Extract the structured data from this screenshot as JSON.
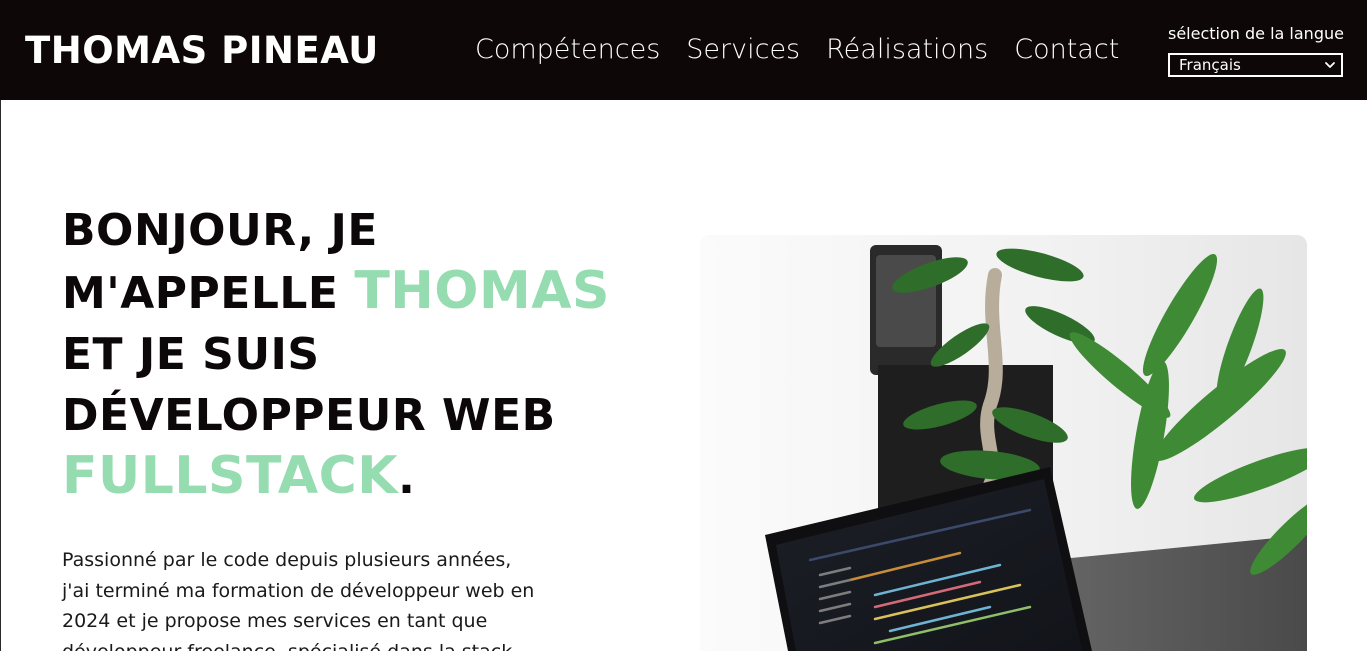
{
  "header": {
    "brand": "THOMAS PINEAU",
    "nav": [
      "Compétences",
      "Services",
      "Réalisations",
      "Contact"
    ],
    "lang_label": "sélection de la langue",
    "lang_selected": "Français"
  },
  "hero": {
    "title_1": "BONJOUR, JE M'APPELLE ",
    "title_name": "THOMAS",
    "title_2": " ET JE SUIS DÉVELOPPEUR WEB ",
    "title_stack": "FULLSTACK",
    "title_end": ".",
    "paragraph": "Passionné par le code depuis plusieurs années, j'ai terminé ma formation de développeur web en 2024 et je propose mes services en tant que développeur freelance, spécialisé dans la stack"
  },
  "colors": {
    "header_bg": "#0d0707",
    "accent_green": "#95dcb0",
    "text_dark": "#0c0809"
  },
  "icons": {
    "select": "chevron-down-icon",
    "image": "laptop-plant-photo"
  }
}
